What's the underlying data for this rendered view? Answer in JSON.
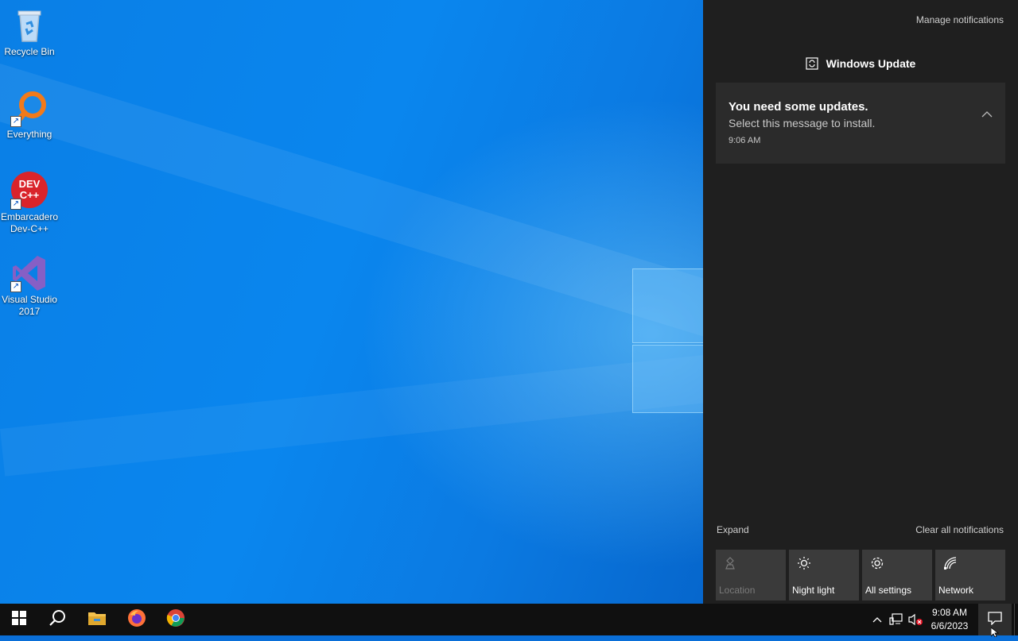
{
  "desktop": {
    "icons": [
      {
        "label": "Recycle Bin",
        "icon": "recycle-bin-icon"
      },
      {
        "label": "Everything",
        "icon": "everything-search-icon"
      },
      {
        "label": "Embarcadero Dev-C++",
        "icon": "devcpp-icon",
        "logo_text": "DEV C++"
      },
      {
        "label": "Visual Studio 2017",
        "icon": "visual-studio-icon"
      }
    ]
  },
  "action_center": {
    "manage_label": "Manage notifications",
    "group_title": "Windows Update",
    "notification": {
      "title": "You need some updates.",
      "body": "Select this message to install.",
      "time": "9:06 AM"
    },
    "expand_label": "Expand",
    "clear_label": "Clear all notifications",
    "quick_actions": [
      {
        "label": "Location",
        "icon": "location-icon",
        "enabled": false
      },
      {
        "label": "Night light",
        "icon": "brightness-icon",
        "enabled": true
      },
      {
        "label": "All settings",
        "icon": "gear-icon",
        "enabled": true
      },
      {
        "label": "Network",
        "icon": "network-icon",
        "enabled": true
      }
    ]
  },
  "taskbar": {
    "pinned": [
      "start-icon",
      "search-icon",
      "file-explorer-icon",
      "firefox-icon",
      "chrome-icon"
    ],
    "clock": {
      "time": "9:08 AM",
      "date": "6/6/2023"
    }
  },
  "colors": {
    "action_center_bg": "#1f1f1f",
    "notification_bg": "#2b2b2b",
    "taskbar_bg": "#101010",
    "wallpaper_blue": "#0a7fe6"
  }
}
